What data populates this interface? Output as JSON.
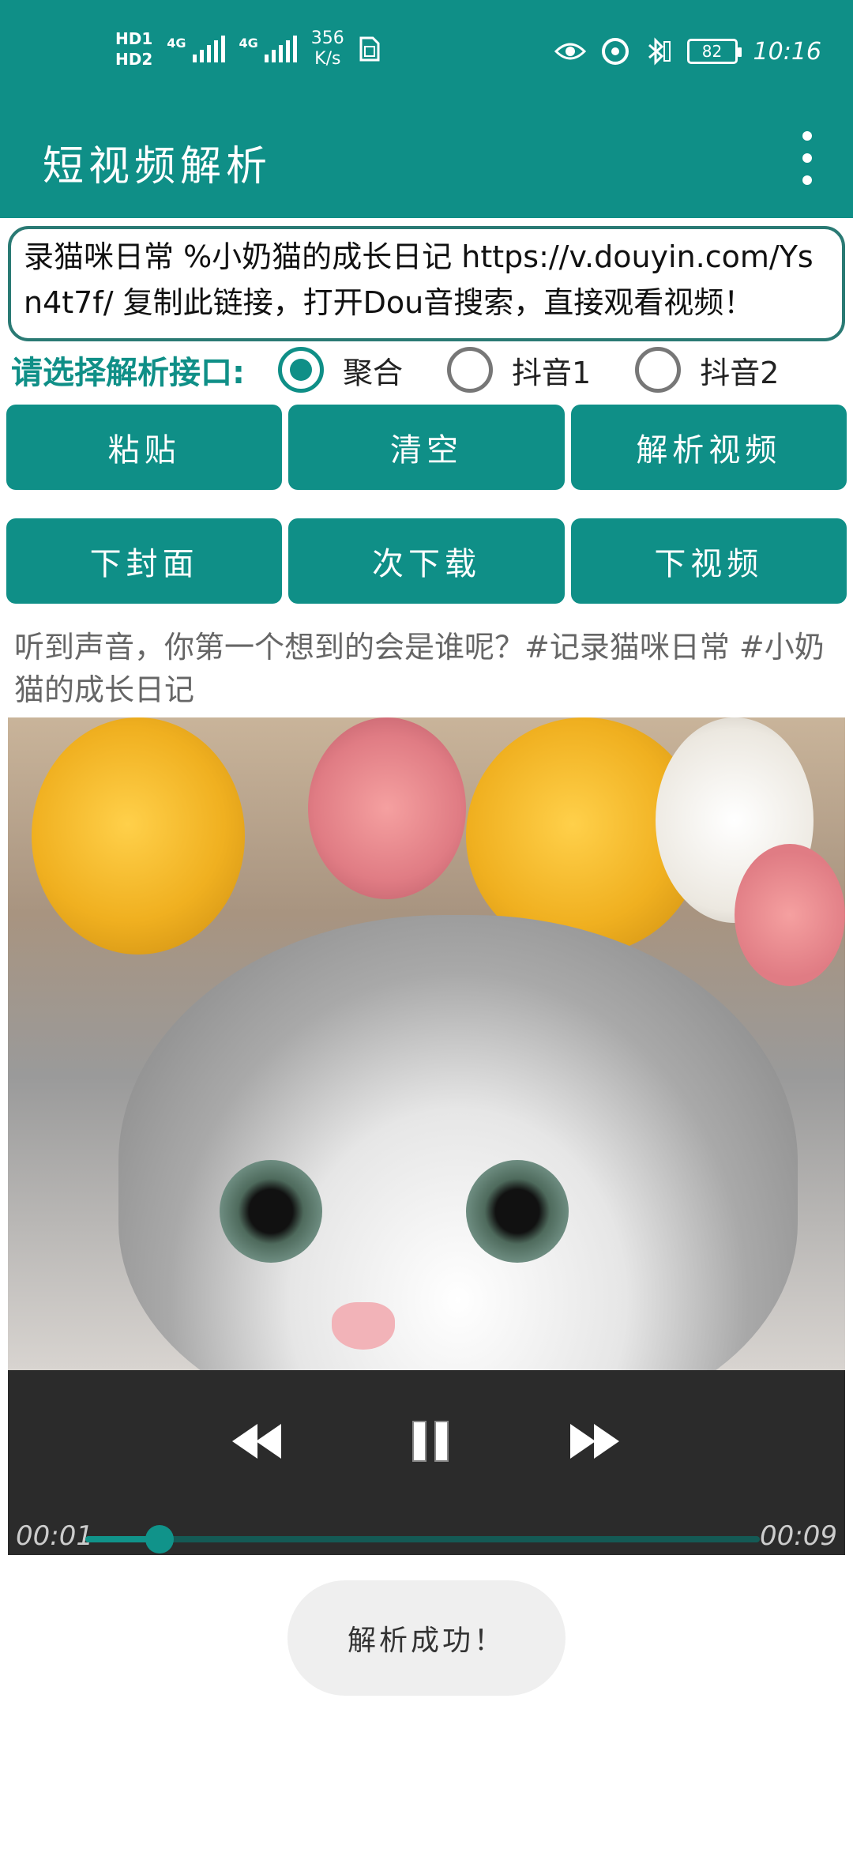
{
  "status_bar": {
    "hd1": "HD1",
    "hd2": "HD2",
    "net1": "4G",
    "net2": "4G",
    "speed_value": "356",
    "speed_unit": "K/s",
    "battery": "82",
    "time": "10:16",
    "icons": [
      "sim-card-icon",
      "eye-icon",
      "alarm-icon",
      "bluetooth-icon",
      "vibrate-icon",
      "battery-icon"
    ]
  },
  "app_bar": {
    "title": "短视频解析",
    "menu_icon": "more-vert-icon"
  },
  "input": {
    "value": "录猫咪日常 %小奶猫的成长日记 https://v.douyin.com/Ysn4t7f/ 复制此链接，打开Dou音搜索，直接观看视频！"
  },
  "interface_select": {
    "label": "请选择解析接口:",
    "options": [
      {
        "label": "聚合",
        "checked": true
      },
      {
        "label": "抖音1",
        "checked": false
      },
      {
        "label": "抖音2",
        "checked": false
      }
    ]
  },
  "buttons_row1": [
    "粘贴",
    "清空",
    "解析视频"
  ],
  "buttons_row2": [
    "下封面",
    "次下载",
    "下视频"
  ],
  "description": "听到声音，你第一个想到的会是谁呢？#记录猫咪日常 #小奶猫的成长日记",
  "player": {
    "current_time": "00:01",
    "duration": "00:09",
    "progress": 0.11,
    "icons": [
      "rewind-icon",
      "pause-icon",
      "fast-forward-icon"
    ]
  },
  "toast": "解析成功！",
  "colors": {
    "primary": "#0f8f87",
    "player_bg": "#2b2b2b",
    "toast_bg": "#efefef"
  }
}
